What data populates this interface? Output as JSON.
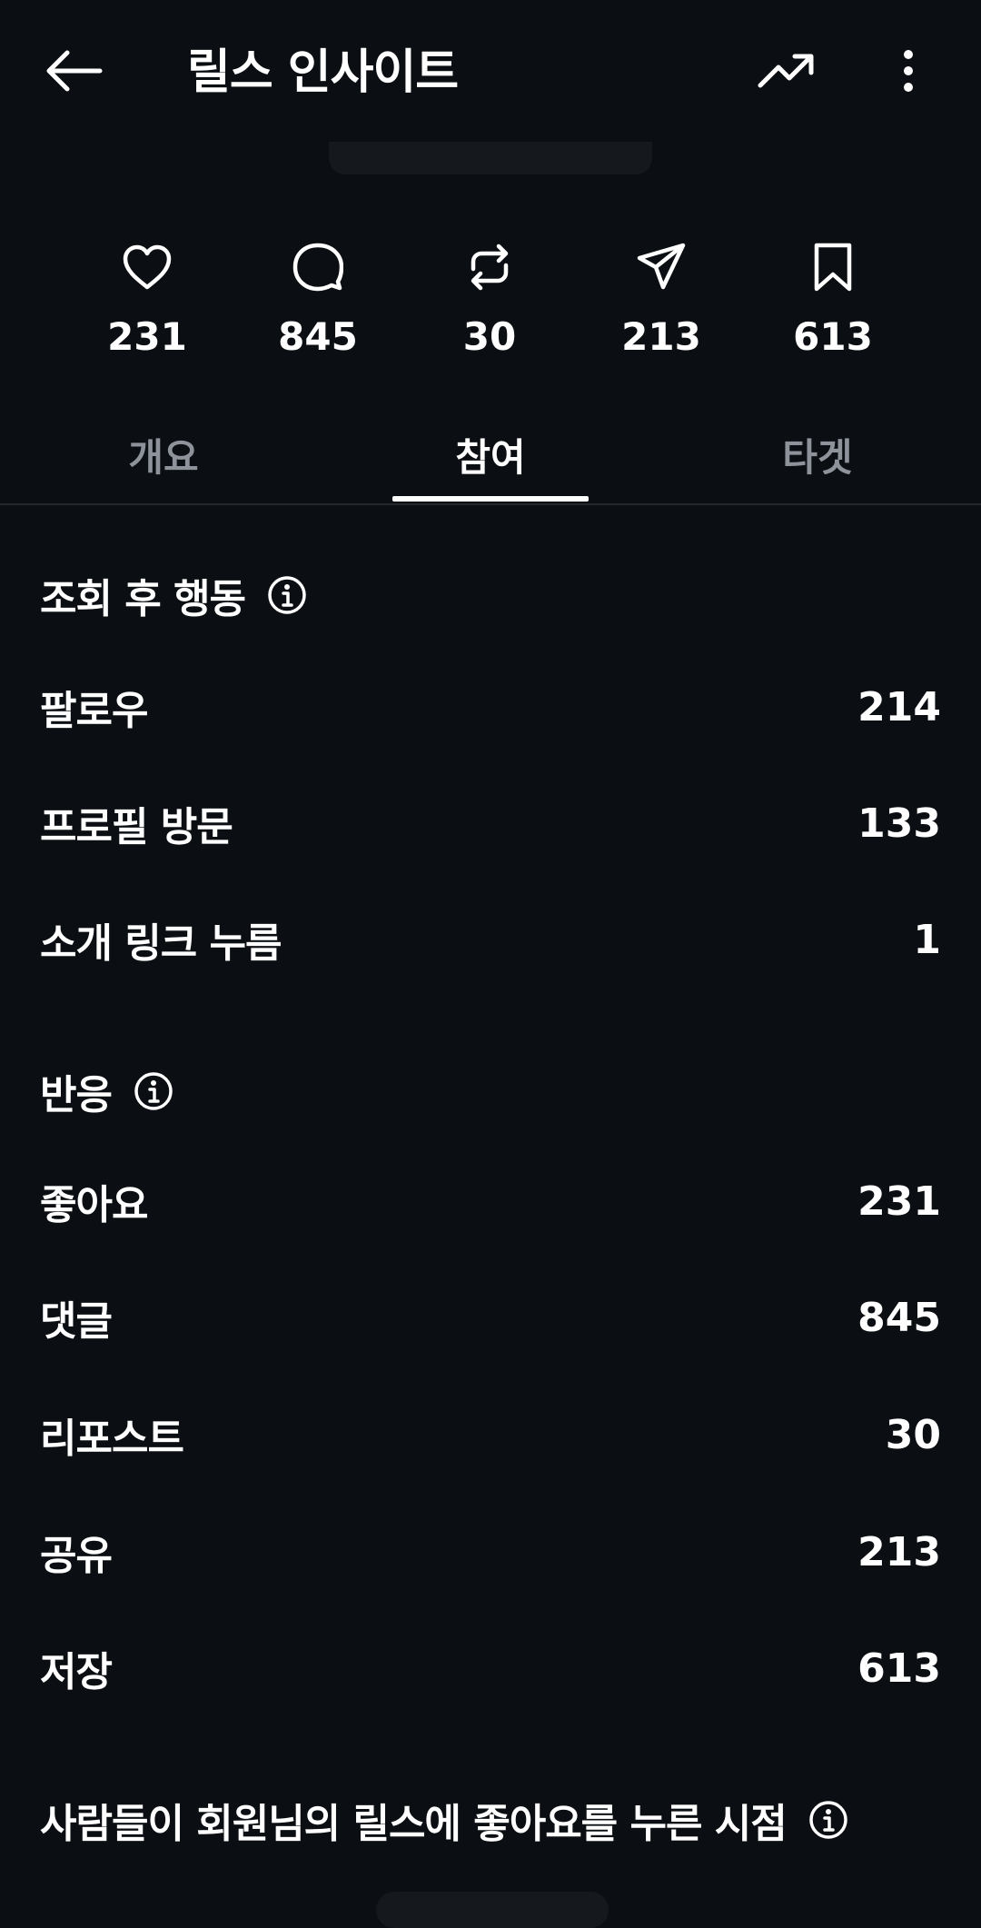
{
  "header": {
    "title": "릴스 인사이트",
    "back_icon": "arrow-left-icon",
    "trend_icon": "trending-up-icon",
    "more_icon": "more-vertical-icon"
  },
  "stats": [
    {
      "icon": "heart-icon",
      "value": "231"
    },
    {
      "icon": "comment-icon",
      "value": "845"
    },
    {
      "icon": "repost-icon",
      "value": "30"
    },
    {
      "icon": "share-icon",
      "value": "213"
    },
    {
      "icon": "bookmark-icon",
      "value": "613"
    }
  ],
  "tabs": [
    {
      "label": "개요",
      "active": false
    },
    {
      "label": "참여",
      "active": true
    },
    {
      "label": "타겟",
      "active": false
    }
  ],
  "post_view_actions": {
    "title": "조회 후 행동",
    "rows": [
      {
        "label": "팔로우",
        "value": "214"
      },
      {
        "label": "프로필 방문",
        "value": "133"
      },
      {
        "label": "소개 링크 누름",
        "value": "1"
      }
    ]
  },
  "reactions": {
    "title": "반응",
    "rows": [
      {
        "label": "좋아요",
        "value": "231"
      },
      {
        "label": "댓글",
        "value": "845"
      },
      {
        "label": "리포스트",
        "value": "30"
      },
      {
        "label": "공유",
        "value": "213"
      },
      {
        "label": "저장",
        "value": "613"
      }
    ]
  },
  "likes_timing": {
    "title": "사람들이 회원님의 릴스에 좋아요를 누른 시점"
  },
  "colors": {
    "background": "#0b0e12",
    "text": "#ffffff",
    "inactive_tab": "#8e939b",
    "divider": "#24282e"
  }
}
